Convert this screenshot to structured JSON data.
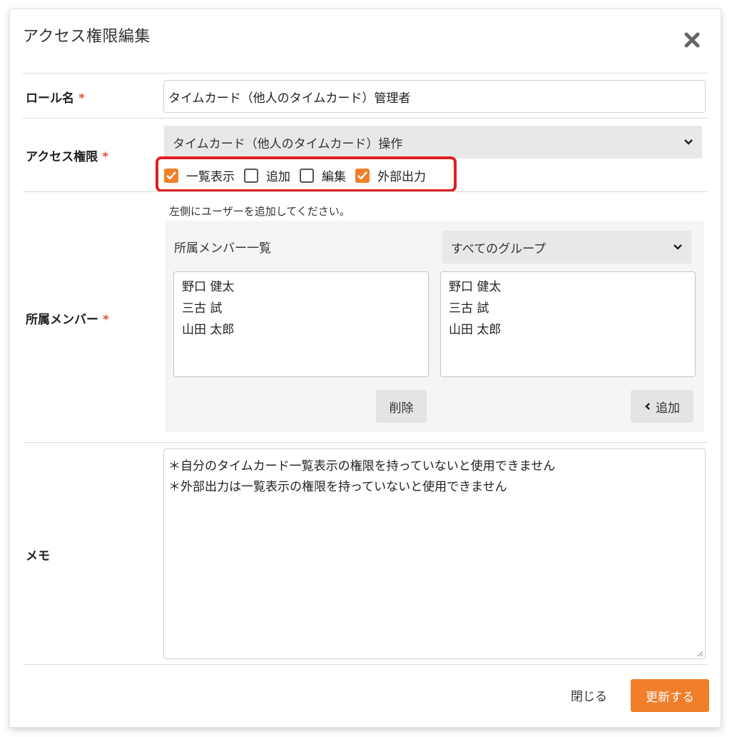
{
  "dialog": {
    "title": "アクセス権限編集",
    "close_icon": "close-icon"
  },
  "fields": {
    "role_name": {
      "label": "ロール名",
      "required_mark": "*",
      "value": "タイムカード（他人のタイムカード）管理者"
    },
    "access": {
      "label": "アクセス権限",
      "required_mark": "*",
      "selected": "タイムカード（他人のタイムカード）操作",
      "permissions": [
        {
          "label": "一覧表示",
          "checked": true
        },
        {
          "label": "追加",
          "checked": false
        },
        {
          "label": "編集",
          "checked": false
        },
        {
          "label": "外部出力",
          "checked": true
        }
      ]
    },
    "members": {
      "label": "所属メンバー",
      "required_mark": "*",
      "hint": "左側にユーザーを追加してください。",
      "panel_title": "所属メンバー一覧",
      "group_select": "すべてのグループ",
      "selected_members": [
        "野口 健太",
        "三古 試",
        "山田 太郎"
      ],
      "available_members": [
        "野口 健太",
        "三古 試",
        "山田 太郎"
      ],
      "delete_label": "削除",
      "add_label": "追加"
    },
    "memo": {
      "label": "メモ",
      "lines": [
        "＊自分のタイムカード一覧表示の権限を持っていないと使用できません",
        "＊外部出力は一覧表示の権限を持っていないと使用できません"
      ]
    }
  },
  "footer": {
    "close_label": "閉じる",
    "submit_label": "更新する"
  },
  "colors": {
    "accent": "#f07e2a",
    "required": "#e5533d",
    "highlight": "#e02020"
  }
}
